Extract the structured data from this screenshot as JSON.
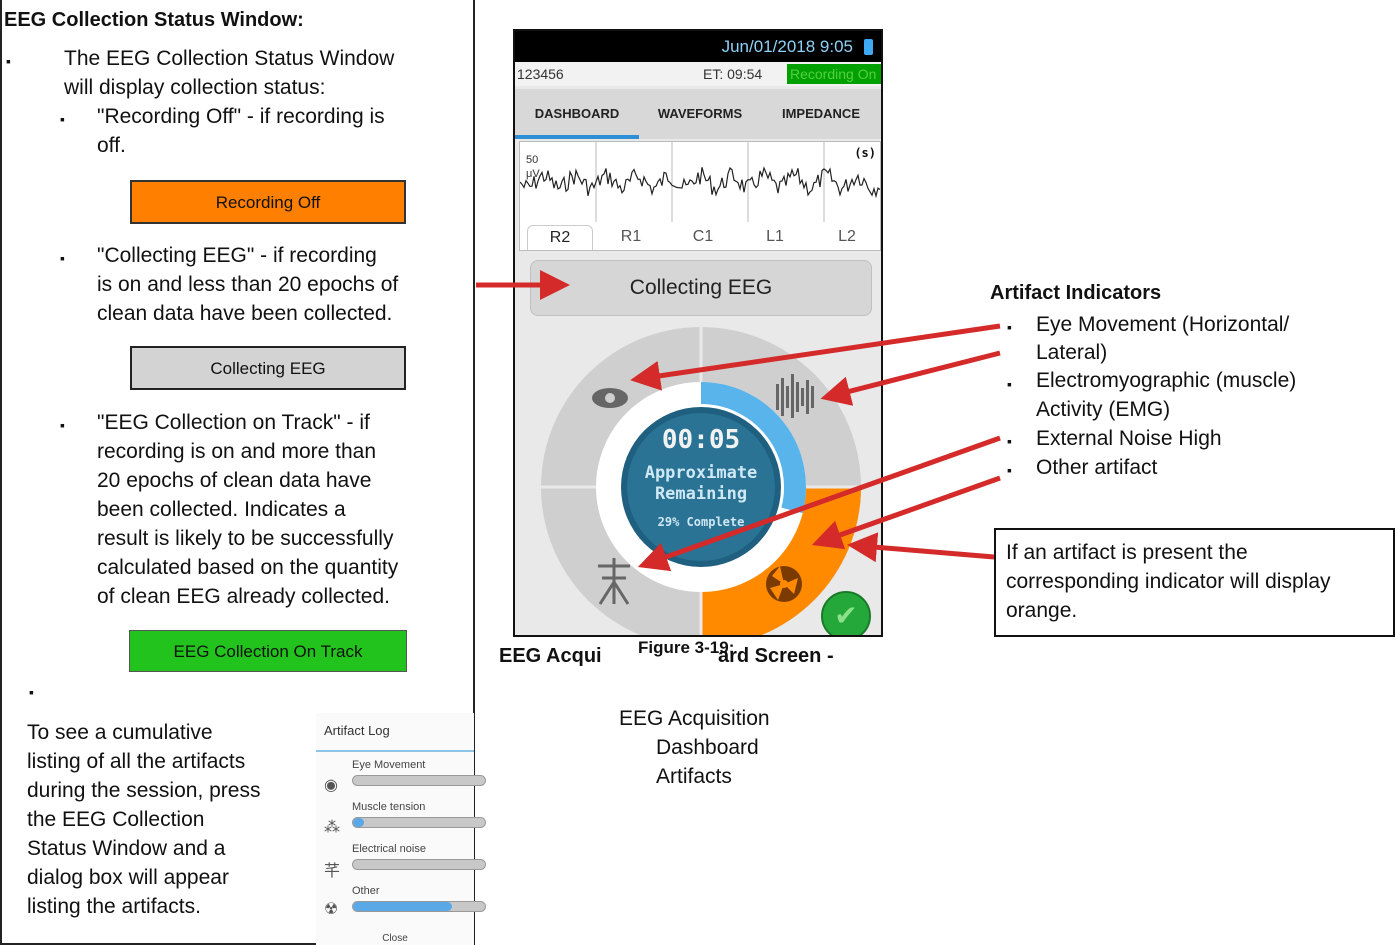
{
  "left": {
    "title": "EEG Collection Status Window:",
    "bullet_glyph": "▪",
    "intro_line1": "The EEG Collection Status Window",
    "intro_line2": "will display collection status:",
    "off_line1": "\"Recording Off\" - if recording is",
    "off_line2": "off.",
    "box_off": "Recording Off",
    "collecting_line1": "\"Collecting EEG\" - if recording",
    "collecting_line2": "is on and less than 20 epochs of",
    "collecting_line3": "clean data have been collected.",
    "box_collecting": "Collecting EEG",
    "ontrack_lines": [
      "\"EEG Collection on Track\" - if",
      "recording is on and more than",
      "20 epochs of clean data have",
      "been collected. Indicates a",
      "result is likely to be successfully",
      "calculated based on the quantity",
      "of clean EEG already collected."
    ],
    "box_ontrack": "EEG Collection On Track",
    "log_lines": [
      "To see a cumulative",
      "listing of all the artifacts",
      "during the session, press",
      "the EEG Collection",
      "Status Window and a",
      "dialog box will appear",
      "listing the artifacts."
    ]
  },
  "artifact_log": {
    "title": "Artifact Log",
    "items": [
      {
        "label": "Eye Movement",
        "icon": "eye-icon",
        "fill": 0.0
      },
      {
        "label": "Muscle tension",
        "icon": "muscle-icon",
        "fill": 0.08
      },
      {
        "label": "Electrical noise",
        "icon": "power-line-icon",
        "fill": 0.0
      },
      {
        "label": "Other",
        "icon": "other-artifact-icon",
        "fill": 0.75
      }
    ],
    "close_label": "Close"
  },
  "phone": {
    "datetime": "Jun/01/2018 9:05",
    "patient_id": "123456",
    "elapsed": "ET: 09:54",
    "recording_badge": "Recording On",
    "tabs": [
      "DASHBOARD",
      "WAVEFORMS",
      "IMPEDANCE"
    ],
    "scale_value": "50",
    "scale_unit": "μV",
    "scale_s": "(s)",
    "channels": [
      "R2",
      "R1",
      "C1",
      "L1",
      "L2"
    ],
    "status_button": "Collecting EEG",
    "timer": "00:05",
    "timer_line1": "Approximate",
    "timer_line2": "Remaining",
    "progress_text": "29% Complete",
    "progress_fraction": 0.29,
    "check_glyph": "✔"
  },
  "captions": {
    "part1": "EEG Acqui",
    "part2": "Figure 3-19:",
    "part3": "ard Screen -",
    "lines": [
      "EEG Acquisition",
      "Dashboard",
      "Artifacts"
    ]
  },
  "artifact_indicators": {
    "title": "Artifact Indicators",
    "items": [
      [
        "Eye Movement (Horizontal/",
        "Lateral)"
      ],
      [
        "Electromyographic (muscle)",
        "Activity (EMG)"
      ],
      [
        "External Noise High"
      ],
      [
        "Other artifact"
      ]
    ],
    "note": "If an artifact is present the corresponding indicator will display orange."
  },
  "colors": {
    "orange": "#ff7f00",
    "gray": "#d3d3d3",
    "green": "#22c31c",
    "arrow": "#d42a2a",
    "progress_blue": "#5ab4ec"
  }
}
